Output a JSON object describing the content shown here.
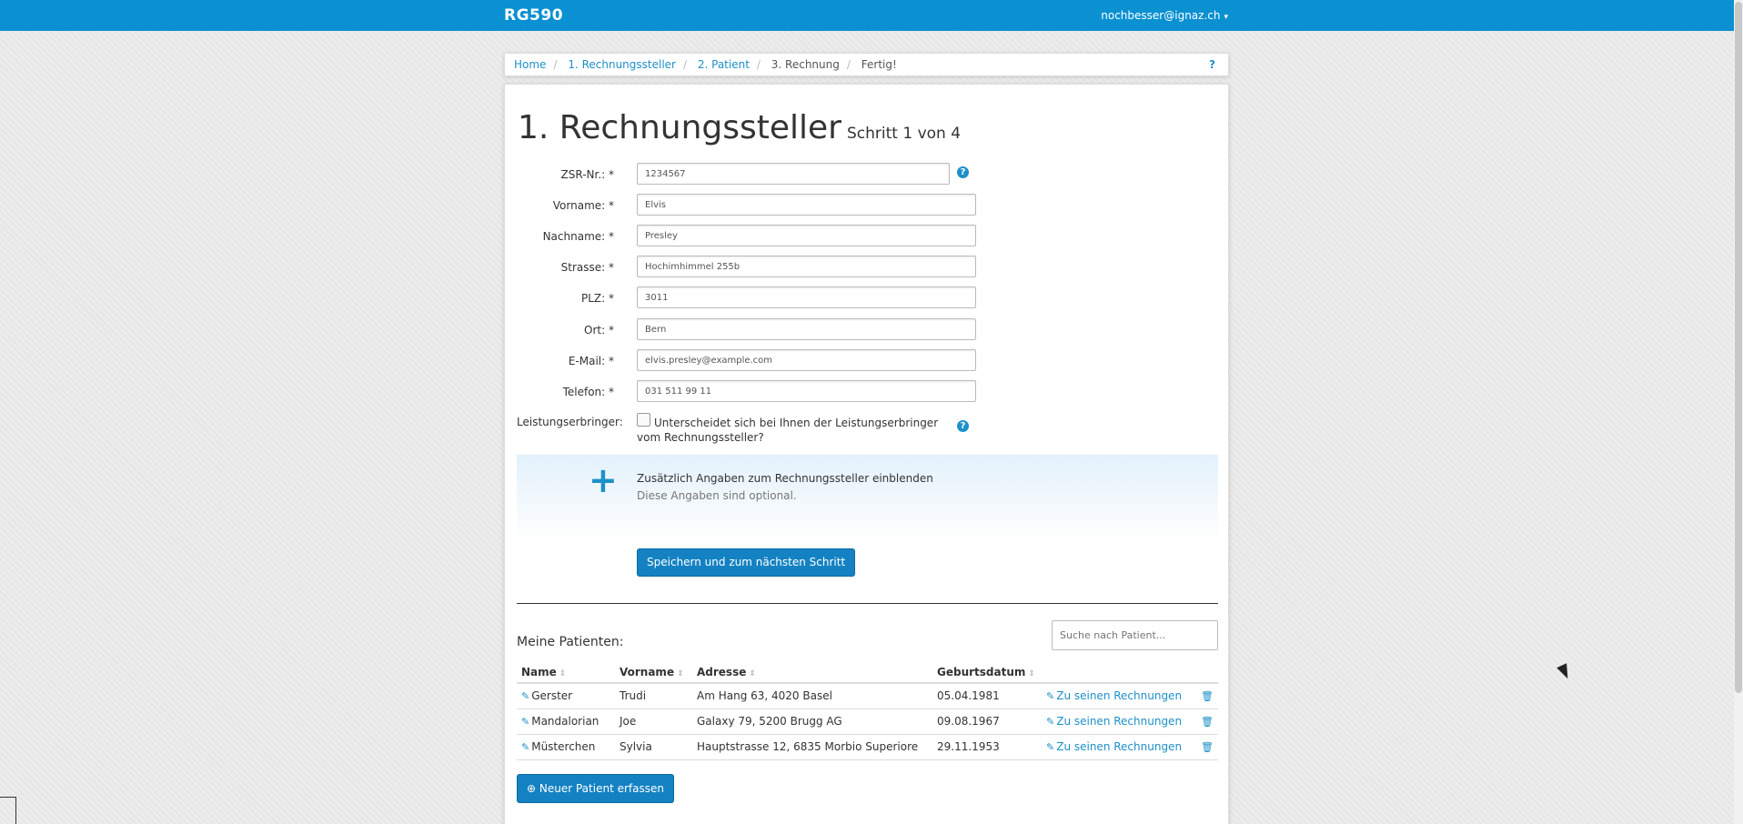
{
  "topbar": {
    "brand": "RG590",
    "user": "nochbesser@ignaz.ch",
    "user_caret": "▾"
  },
  "breadcrumb": {
    "items": [
      "Home",
      "1. Rechnungssteller",
      "2. Patient",
      "3. Rechnung",
      "Fertig!"
    ],
    "separator": "/",
    "help": "?"
  },
  "page": {
    "title": "1. Rechnungssteller",
    "subtitle": "Schritt 1 von 4"
  },
  "form": {
    "fields": [
      {
        "label": "ZSR-Nr.: *",
        "value": "1234567"
      },
      {
        "label": "Vorname: *",
        "value": "Elvis"
      },
      {
        "label": "Nachname: *",
        "value": "Presley"
      },
      {
        "label": "Strasse: *",
        "value": "Hochimhimmel 255b"
      },
      {
        "label": "PLZ: *",
        "value": "3011"
      },
      {
        "label": "Ort: *",
        "value": "Bern"
      },
      {
        "label": "E-Mail: *",
        "value": "elvis.presley@example.com"
      },
      {
        "label": "Telefon: *",
        "value": "031 511 99 11"
      }
    ],
    "help_icon": "?",
    "provider_label": "Leistungserbringer:",
    "provider_checkbox_text": "Unterscheidet sich bei Ihnen der Leistungserbringer vom Rechnungssteller?",
    "provider_checked": false,
    "expander_icon": "+",
    "expander_title": "Zusätzlich Angaben zum Rechnungssteller einblenden",
    "expander_note": "Diese Angaben sind optional.",
    "submit_label": "Speichern und zum nächsten Schritt"
  },
  "patients": {
    "title": "Meine Patienten:",
    "search_placeholder": "Suche nach Patient...",
    "columns": [
      "Name",
      "Vorname",
      "Adresse",
      "Geburtsdatum"
    ],
    "sort_icon": "⇕",
    "rows": [
      {
        "name": "Gerster",
        "vorname": "Trudi",
        "adresse": "Am Hang 63, 4020 Basel",
        "geburtsdatum": "05.04.1981",
        "link": "Zu seinen Rechnungen"
      },
      {
        "name": "Mandalorian",
        "vorname": "Joe",
        "adresse": "Galaxy 79, 5200 Brugg AG",
        "geburtsdatum": "09.08.1967",
        "link": "Zu seinen Rechnungen"
      },
      {
        "name": "Müsterchen",
        "vorname": "Sylvia",
        "adresse": "Hauptstrasse 12, 6835 Morbio Superiore",
        "geburtsdatum": "29.11.1953",
        "link": "Zu seinen Rechnungen"
      }
    ],
    "new_button_label": "Neuer Patient erfassen",
    "new_button_icon": "⊕"
  },
  "colors": {
    "primary": "#0b91d2",
    "button": "#1482c2",
    "link": "#1e90c8"
  },
  "icons": {
    "edit": "pencil-icon",
    "delete": "trash-icon",
    "help": "question-circle-icon"
  }
}
